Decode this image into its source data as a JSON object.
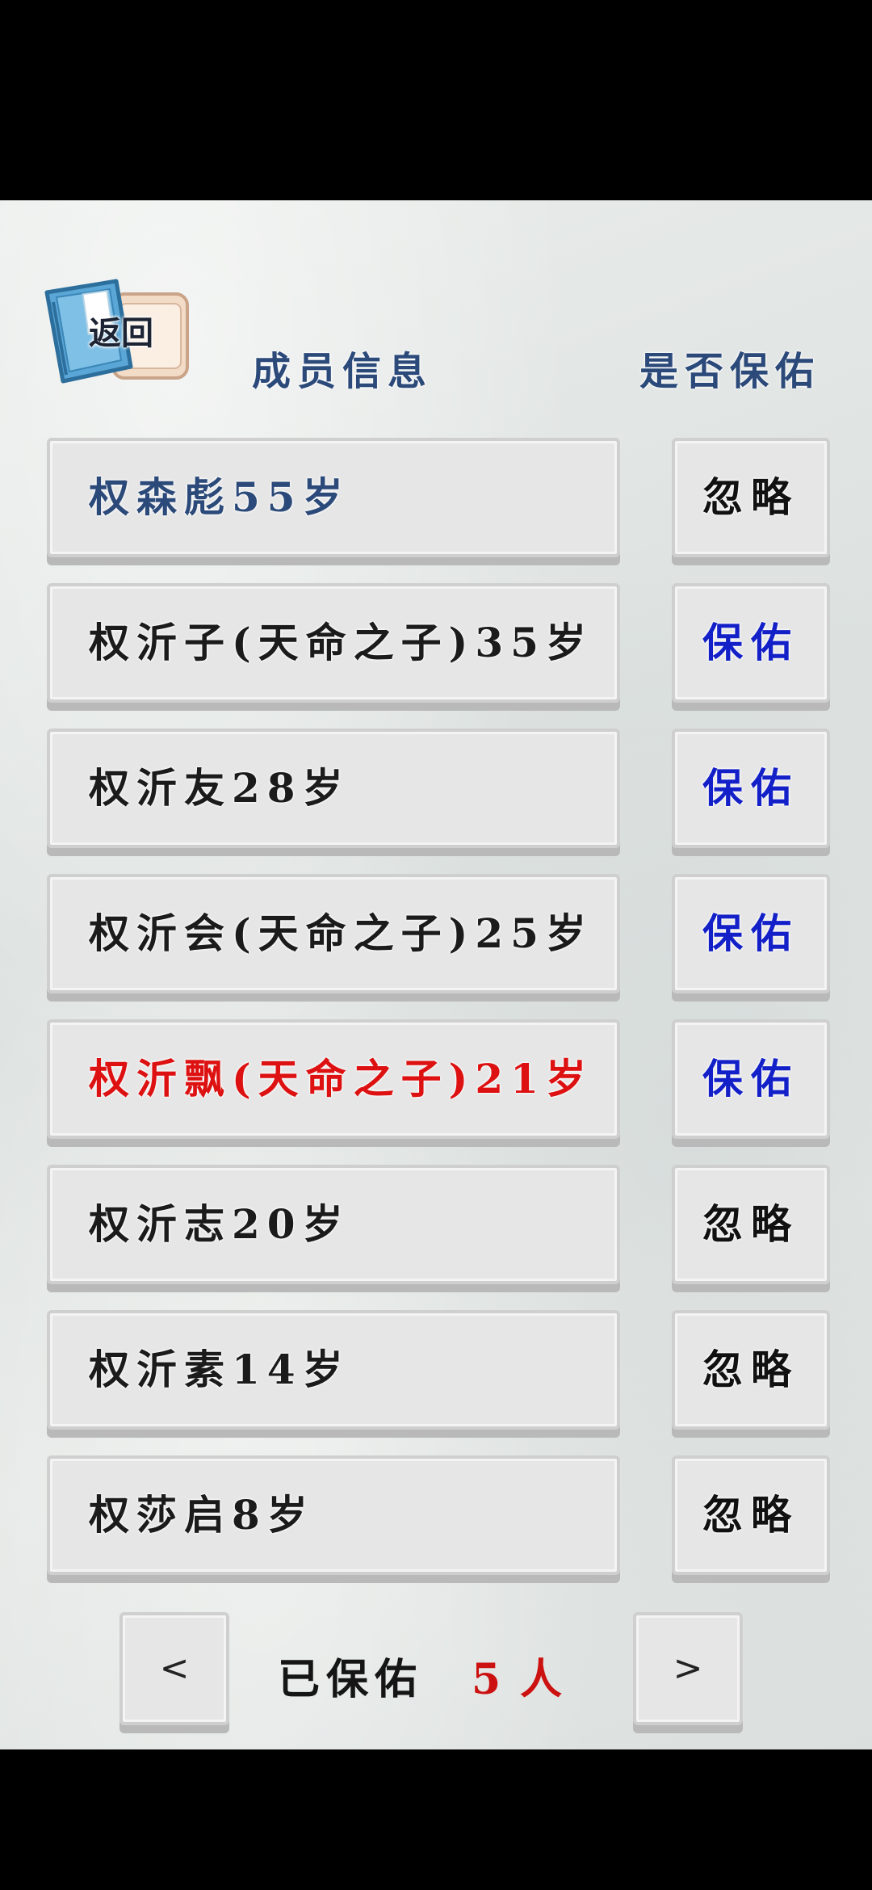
{
  "header": {
    "back_label": "返回",
    "col_info": "成员信息",
    "col_protect": "是否保佑"
  },
  "colors": {
    "name_default": "#1b1b1b",
    "name_head": "#2b4a7a",
    "name_highlight": "#dd1111",
    "protect_blue": "#1320c8"
  },
  "members": [
    {
      "name": "权森彪55岁",
      "action": "忽略",
      "style": "head"
    },
    {
      "name": "权沂子(天命之子)35岁",
      "action": "保佑",
      "style": "normal"
    },
    {
      "name": "权沂友28岁",
      "action": "保佑",
      "style": "normal"
    },
    {
      "name": "权沂会(天命之子)25岁",
      "action": "保佑",
      "style": "normal"
    },
    {
      "name": "权沂飘(天命之子)21岁",
      "action": "保佑",
      "style": "highlight"
    },
    {
      "name": "权沂志20岁",
      "action": "忽略",
      "style": "normal"
    },
    {
      "name": "权沂素14岁",
      "action": "忽略",
      "style": "normal"
    },
    {
      "name": "权莎启8岁",
      "action": "忽略",
      "style": "normal"
    }
  ],
  "footer": {
    "prev_label": "<",
    "next_label": ">",
    "summary_label": "已保佑",
    "summary_count": "5",
    "summary_unit": "人"
  }
}
